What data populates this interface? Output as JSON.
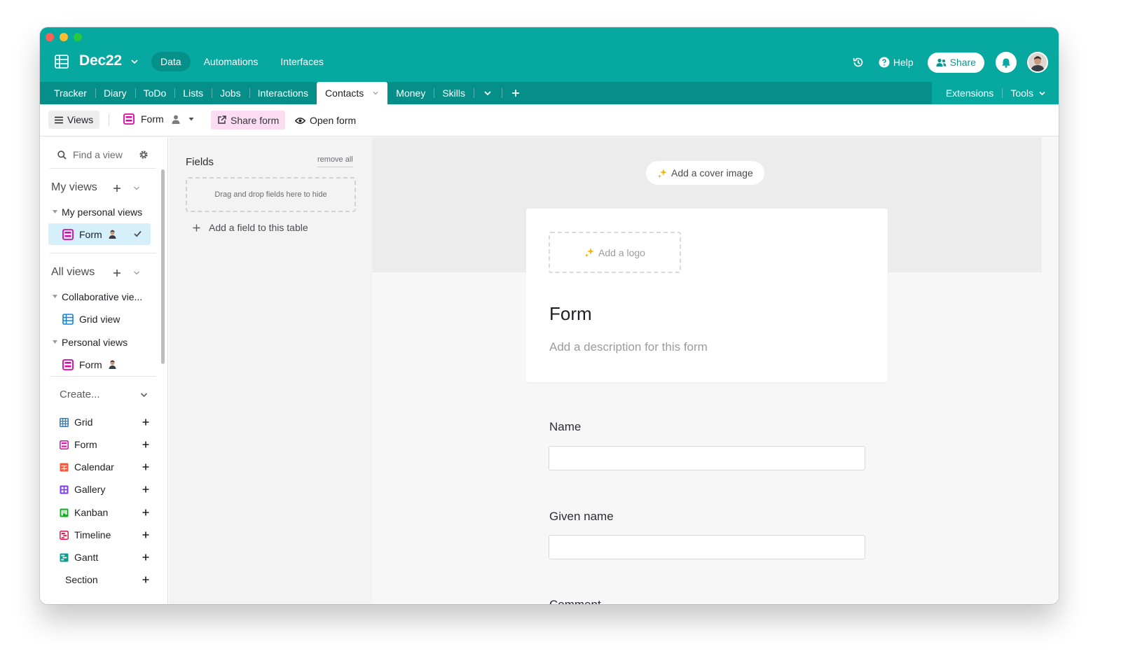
{
  "window": {
    "traffic_lights": [
      "#fe5f57",
      "#febc2e",
      "#28c840"
    ]
  },
  "colors": {
    "header": "#07a8a0",
    "tabbar": "#068f89",
    "share_form_bg": "#fbdcf1",
    "selected_view_bg": "#d5f0fa"
  },
  "header": {
    "base_name": "Dec22",
    "nav": [
      {
        "label": "Data",
        "active": true
      },
      {
        "label": "Automations",
        "active": false
      },
      {
        "label": "Interfaces",
        "active": false
      }
    ],
    "help_label": "Help",
    "share_label": "Share"
  },
  "tables": {
    "tabs": [
      "Tracker",
      "Diary",
      "ToDo",
      "Lists",
      "Jobs",
      "Interactions",
      "Contacts",
      "Money",
      "Skills"
    ],
    "active_tab": "Contacts",
    "extensions_label": "Extensions",
    "tools_label": "Tools"
  },
  "viewbar": {
    "views_label": "Views",
    "current_view": "Form",
    "share_form_label": "Share form",
    "open_form_label": "Open form"
  },
  "sidebar": {
    "search_placeholder": "Find a view",
    "my_views_title": "My views",
    "my_personal_views_group": "My personal views",
    "my_form_item": "Form",
    "all_views_title": "All views",
    "collab_group": "Collaborative vie...",
    "grid_view_item": "Grid view",
    "personal_group": "Personal views",
    "personal_form_item": "Form",
    "create_title": "Create...",
    "create_items": [
      {
        "label": "Grid",
        "icon": "grid-icon",
        "color": "#1283da"
      },
      {
        "label": "Form",
        "icon": "form-icon",
        "color": "#dd04a8"
      },
      {
        "label": "Calendar",
        "icon": "calendar-icon",
        "color": "#f2583e"
      },
      {
        "label": "Gallery",
        "icon": "gallery-icon",
        "color": "#7c39ed"
      },
      {
        "label": "Kanban",
        "icon": "kanban-icon",
        "color": "#11af22"
      },
      {
        "label": "Timeline",
        "icon": "timeline-icon",
        "color": "#e1164b"
      },
      {
        "label": "Gantt",
        "icon": "gantt-icon",
        "color": "#0f9a8e"
      },
      {
        "label": "Section",
        "icon": "",
        "color": ""
      }
    ]
  },
  "fields_panel": {
    "title": "Fields",
    "remove_all": "remove all",
    "dropzone": "Drag and drop fields here to hide",
    "add_field": "Add a field to this table"
  },
  "form": {
    "cover_button": "Add a cover image",
    "logo_button": "Add a logo",
    "title": "Form",
    "description_placeholder": "Add a description for this form",
    "questions": [
      {
        "label": "Name",
        "value": ""
      },
      {
        "label": "Given name",
        "value": ""
      },
      {
        "label": "Comment",
        "value": ""
      }
    ]
  }
}
